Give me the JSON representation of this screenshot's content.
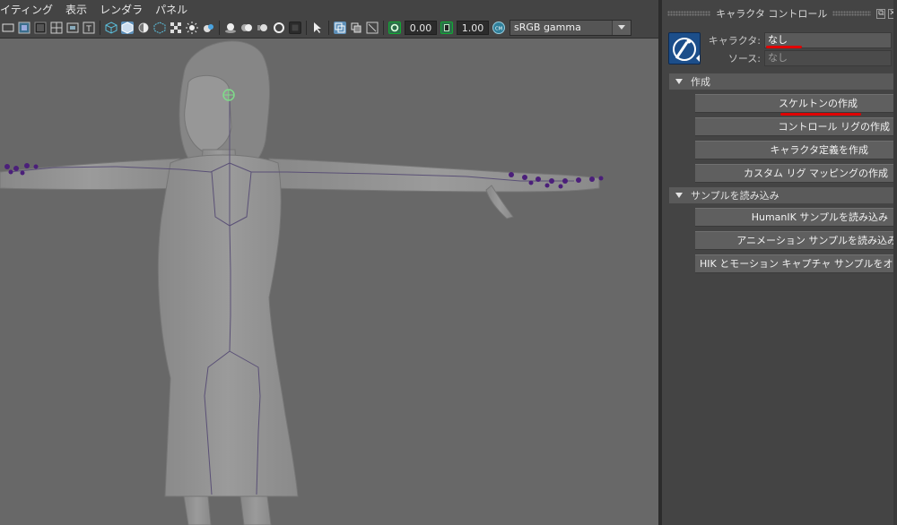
{
  "viewport": {
    "menu": [
      "イティング",
      "表示",
      "レンダラ",
      "パネル"
    ],
    "toolbar": {
      "exposure_value": "0.00",
      "gamma_value": "1.00",
      "color_space": "sRGB gamma",
      "icons": [
        "camera-attr-icon",
        "frame-icon",
        "film-gate-icon",
        "grid-icon",
        "resolution-gate-icon",
        "text-icon",
        "wireframe-icon",
        "smooth-shade-icon",
        "shade-sel-icon",
        "xray-joints-icon",
        "checker-icon",
        "light-icon",
        "ambient-icon",
        "shadow-icon",
        "ssao-icon",
        "motion-blur-icon",
        "aa-icon",
        "isolate-icon",
        "select-icon",
        "xray-icon",
        "dof-icon",
        "camera-cube-icon",
        "exposure-icon",
        "gamma-icon",
        "view-transform-icon"
      ]
    }
  },
  "panel": {
    "title": "キャラクタ コントロール",
    "character_label": "キャラクタ:",
    "character_value": "なし",
    "source_label": "ソース:",
    "source_value": "なし",
    "sections": [
      {
        "title": "作成",
        "buttons": [
          "スケルトンの作成",
          "コントロール リグの作成",
          "キャラクタ定義を作成",
          "カスタム リグ マッピングの作成"
        ]
      },
      {
        "title": "サンプルを読み込み",
        "buttons": [
          "HumanIK サンプルを読み込み",
          "アニメーション サンプルを読み込み",
          "HIK とモーション キャプチャ サンプルをオンライ"
        ]
      }
    ],
    "colors": {
      "accent_blue": "#1c4e8a",
      "annotation_red": "#e00000",
      "joint_green": "#7fdc8a",
      "joint_purple": "#4b1f7a"
    }
  }
}
